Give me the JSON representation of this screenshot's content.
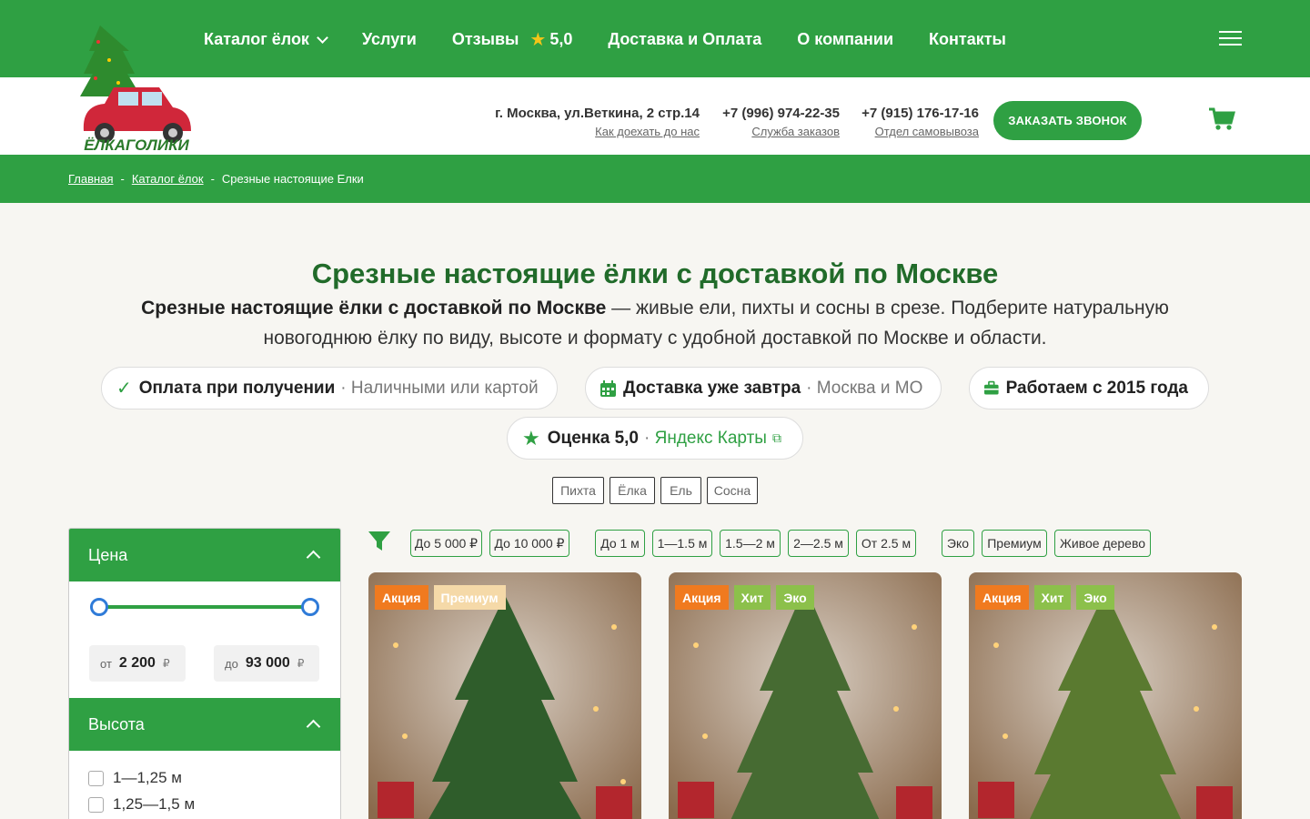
{
  "nav": {
    "catalog": "Каталог ёлок",
    "services": "Услуги",
    "reviews": "Отзывы",
    "rating": "5,0",
    "delivery": "Доставка и Оплата",
    "about": "О компании",
    "contacts": "Контакты"
  },
  "logo_text": "ЁЛКАГОЛИКИ",
  "header": {
    "address": "г. Москва, ул.Веткина, 2 стр.14",
    "address_link": "Как доехать до нас",
    "phone1": "+7 (996) 974-22-35",
    "phone1_link": "Служба заказов",
    "phone2": "+7 (915) 176-17-16",
    "phone2_link": "Отдел самовывоза",
    "call_button": "ЗАКАЗАТЬ ЗВОНОК"
  },
  "breadcrumbs": [
    "Главная",
    "Каталог ёлок",
    "Срезные настоящие Елки"
  ],
  "page": {
    "title": "Срезные настоящие ёлки с доставкой по Москве",
    "lead_bold": "Срезные настоящие ёлки с доставкой по Москве",
    "lead_rest": " — живые ели, пихты и сосны в срезе. Подберите натуральную новогоднюю ёлку по виду, высоте и формату с удобной доставкой по Москве и области."
  },
  "features": [
    {
      "title": "Оплата при получении",
      "sub": "Наличными или картой"
    },
    {
      "title": "Доставка уже завтра",
      "sub": "Москва и МО"
    },
    {
      "title": "Работаем с 2015 года",
      "sub": ""
    },
    {
      "title": "Оценка 5,0",
      "sub": "Яндекс Карты"
    }
  ],
  "species_tags": [
    "Пихта",
    "Ёлка",
    "Ель",
    "Сосна"
  ],
  "filters": [
    "До 5 000 ₽",
    "До 10 000 ₽",
    "До 1 м",
    "1—1.5 м",
    "1.5—2 м",
    "2—2.5 м",
    "От 2.5 м",
    "Эко",
    "Премиум",
    "Живое дерево"
  ],
  "sidebar": {
    "price_title": "Цена",
    "price_from_label": "от",
    "price_from": "2 200",
    "price_to_label": "до",
    "price_to": "93 000",
    "currency": "₽",
    "height_title": "Высота",
    "heights": [
      "1—1,25 м",
      "1,25—1,5 м"
    ]
  },
  "cards": [
    {
      "badges": [
        "Акция",
        "Премиум"
      ]
    },
    {
      "badges": [
        "Акция",
        "Хит",
        "Эко"
      ]
    },
    {
      "badges": [
        "Акция",
        "Хит",
        "Эко"
      ]
    }
  ],
  "colors": {
    "brand": "#2fa043",
    "title": "#216b2a",
    "promo": "#f07a1f",
    "hit": "#8cc04b"
  }
}
